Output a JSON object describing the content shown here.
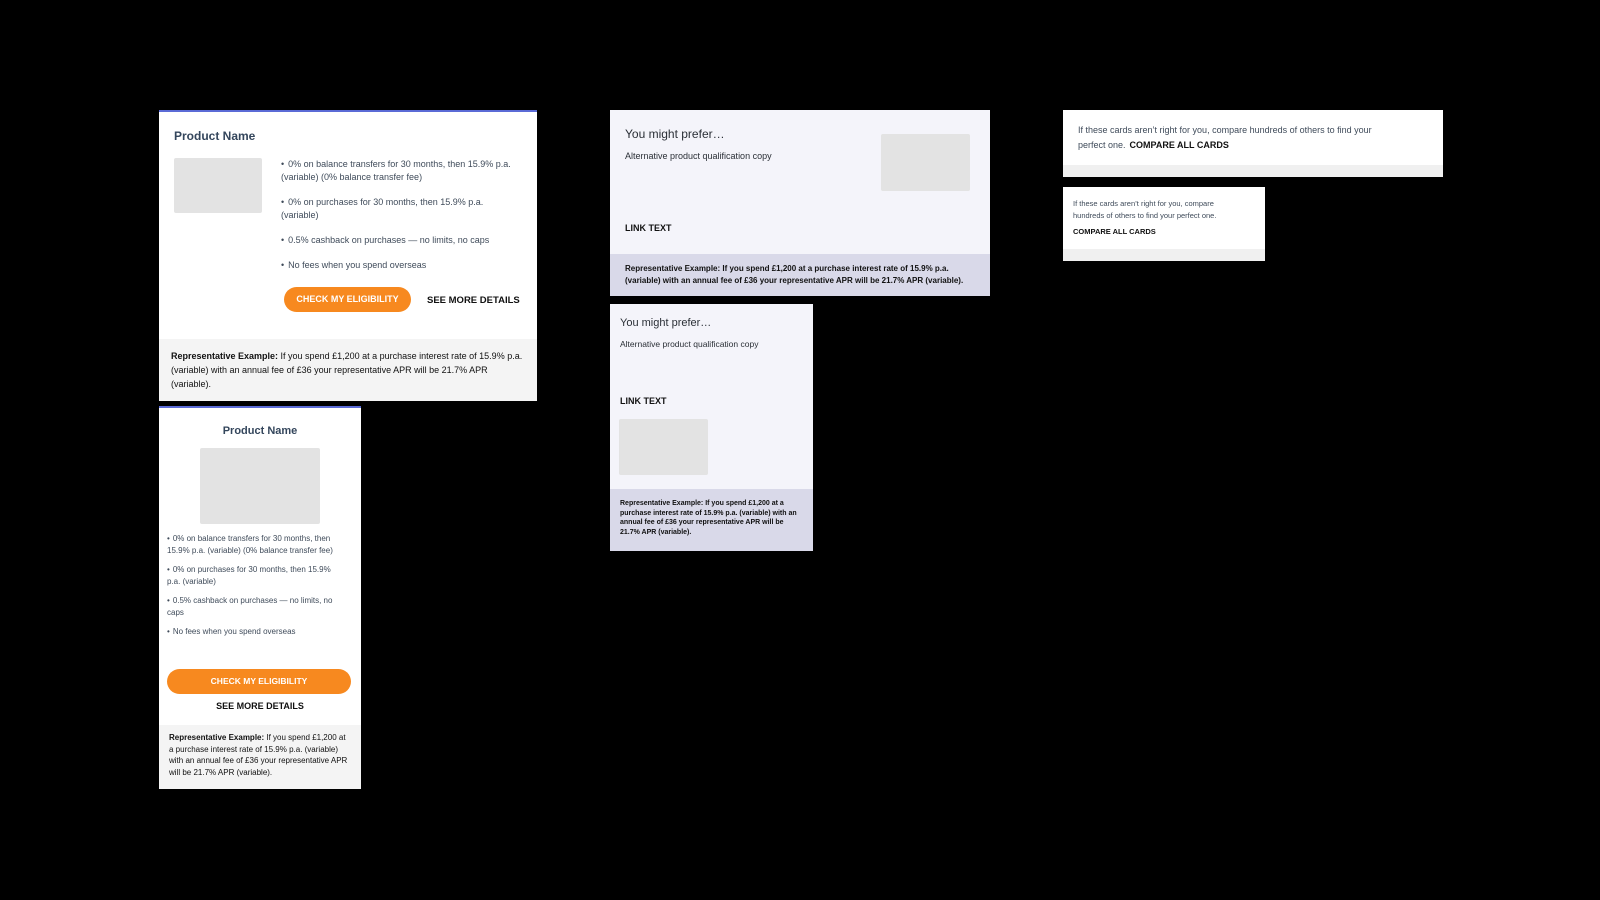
{
  "product_card_large": {
    "title": "Product Name",
    "features": [
      "0% on balance transfers for 30 months, then 15.9% p.a. (variable) (0% balance transfer fee)",
      "0% on purchases for 30 months, then 15.9% p.a. (variable)",
      "0.5% cashback on purchases — no limits, no caps",
      "No fees when you spend overseas"
    ],
    "cta_label": "CHECK MY ELIGIBILITY",
    "details_label": "SEE MORE DETAILS",
    "rep_example_label": "Representative Example:",
    "rep_example_text": " If you spend £1,200 at a purchase interest rate of 15.9% p.a. (variable) with an annual fee of £36 your representative APR will be 21.7% APR (variable)."
  },
  "product_card_small": {
    "title": "Product Name",
    "features": [
      "0% on balance transfers for 30 months, then 15.9% p.a. (variable) (0% balance transfer fee)",
      "0% on purchases for 30 months, then 15.9% p.a. (variable)",
      "0.5% cashback on purchases — no limits, no caps",
      "No fees when you spend overseas"
    ],
    "cta_label": "CHECK MY ELIGIBILITY",
    "details_label": "SEE MORE DETAILS",
    "rep_example_label": "Representative Example:",
    "rep_example_text": " If you spend £1,200 at a purchase interest rate of 15.9% p.a. (variable) with an annual fee of £36 your representative APR will be 21.7% APR (variable)."
  },
  "alt_wide": {
    "heading": "You might prefer…",
    "copy": "Alternative product qualification copy",
    "link": "LINK TEXT",
    "rep_example": "Representative Example: If you spend £1,200 at a purchase interest rate of 15.9% p.a. (variable) with an annual fee of £36 your representative APR will be 21.7% APR (variable)."
  },
  "alt_narrow": {
    "heading": "You might prefer…",
    "copy": "Alternative product qualification copy",
    "link": "LINK TEXT",
    "rep_example": "Representative Example: If you spend £1,200 at a purchase interest rate of 15.9% p.a. (variable) with an annual fee of £36 your representative APR will be 21.7% APR (variable)."
  },
  "compare_wide": {
    "text": "If these cards aren’t right for you, compare hundreds of others to find your perfect one.",
    "cta": "COMPARE ALL CARDS"
  },
  "compare_narrow": {
    "text": "If these cards aren’t right for you, compare hundreds of others to find your perfect one.",
    "cta": "COMPARE ALL CARDS"
  },
  "colors": {
    "accent_border": "#5b6bd6",
    "cta_orange": "#f7891f",
    "alt_bg": "#f4f4fa",
    "alt_rep_bg": "#d9d9e9"
  }
}
